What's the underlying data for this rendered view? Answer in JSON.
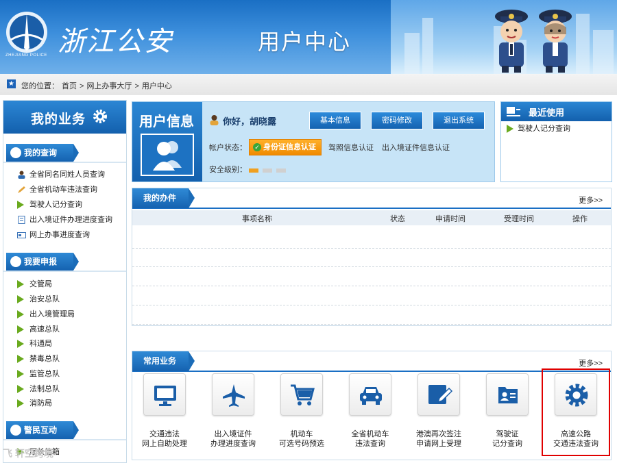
{
  "header": {
    "logo_text": "浙江公安",
    "logo_sub": "ZHEJIANG POLICE",
    "title": "用户中心"
  },
  "breadcrumb": {
    "prefix": "您的位置：",
    "items": [
      "首页",
      ">",
      "网上办事大厅",
      ">",
      "用户中心"
    ]
  },
  "sidebar": {
    "title": "我的业务",
    "sections": [
      {
        "label": "我的查询",
        "items": [
          {
            "label": "全省同名同姓人员查询",
            "icon": "person-icon"
          },
          {
            "label": "全省机动车违法查询",
            "icon": "pencil-icon"
          },
          {
            "label": "驾驶人记分查询",
            "icon": "arrow-icon"
          },
          {
            "label": "出入境证件办理进度查询",
            "icon": "document-icon"
          },
          {
            "label": "网上办事进度查询",
            "icon": "card-icon"
          }
        ]
      },
      {
        "label": "我要申报",
        "items": [
          {
            "label": "交管局"
          },
          {
            "label": "治安总队"
          },
          {
            "label": "出入境管理局"
          },
          {
            "label": "高速总队"
          },
          {
            "label": "科通局"
          },
          {
            "label": "禁毒总队"
          },
          {
            "label": "监管总队"
          },
          {
            "label": "法制总队"
          },
          {
            "label": "消防局"
          }
        ]
      },
      {
        "label": "警民互动",
        "items": [
          {
            "label": "厅长信箱"
          }
        ]
      }
    ]
  },
  "user_info": {
    "title": "用户信息",
    "greeting": "你好，胡晓露",
    "buttons": [
      "基本信息",
      "密码修改",
      "退出系统"
    ],
    "account_status_label": "帐户状态：",
    "verify_button": "身份证信息认证",
    "other_verifications": [
      "驾照信息认证",
      "出入境证件信息认证"
    ],
    "security_label": "安全级别：",
    "security_level": 1,
    "security_max": 3
  },
  "recent": {
    "title": "最近使用",
    "items": [
      "驾驶人记分查询"
    ]
  },
  "my_tasks": {
    "title": "我的办件",
    "more": "更多>>",
    "columns": [
      "事项名称",
      "状态",
      "申请时间",
      "受理时间",
      "操作"
    ],
    "rows": []
  },
  "common_services": {
    "title": "常用业务",
    "more": "更多>>",
    "items": [
      {
        "line1": "交通违法",
        "line2": "网上自助处理",
        "icon": "monitor-icon"
      },
      {
        "line1": "出入境证件",
        "line2": "办理进度查询",
        "icon": "airplane-icon"
      },
      {
        "line1": "机动车",
        "line2": "可选号码预选",
        "icon": "cart-icon"
      },
      {
        "line1": "全省机动车",
        "line2": "违法查询",
        "icon": "car-icon"
      },
      {
        "line1": "港澳再次签注",
        "line2": "申请网上受理",
        "icon": "edit-icon"
      },
      {
        "line1": "驾驶证",
        "line2": "记分查询",
        "icon": "id-card-icon"
      },
      {
        "line1": "高速公路",
        "line2": "交通违法查询",
        "icon": "gear-icon"
      }
    ]
  },
  "watermark": "飞 轩空跨境",
  "colors": {
    "primary_blue": "#1a6fc4",
    "orange": "#f08a00",
    "green": "#6aaa1e",
    "highlight_red": "#e00000"
  }
}
